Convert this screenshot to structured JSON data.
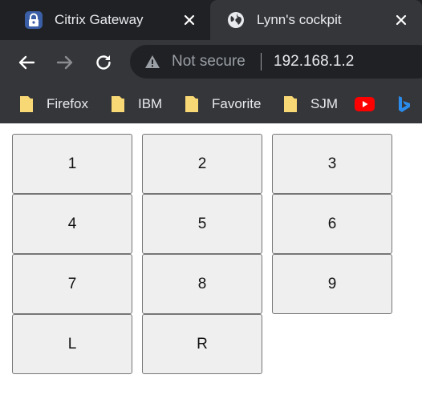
{
  "browser": {
    "tabs": [
      {
        "title": "Citrix Gateway",
        "icon": "citrix-lock-icon",
        "active": false
      },
      {
        "title": "Lynn's cockpit",
        "icon": "globe-icon",
        "active": true
      }
    ],
    "toolbar": {
      "security_label": "Not secure",
      "url": "192.168.1.2"
    },
    "bookmarks": [
      {
        "label": "Firefox",
        "icon": "folder-icon"
      },
      {
        "label": "IBM",
        "icon": "folder-icon"
      },
      {
        "label": "Favorite",
        "icon": "folder-icon"
      },
      {
        "label": "SJM",
        "icon": "folder-icon"
      },
      {
        "label": "",
        "icon": "youtube-icon"
      },
      {
        "label": "",
        "icon": "bing-icon"
      }
    ]
  },
  "keypad": {
    "keys": [
      "1",
      "2",
      "3",
      "4",
      "5",
      "6",
      "7",
      "8",
      "9",
      "L",
      "R"
    ]
  },
  "colors": {
    "tabstrip_bg": "#202124",
    "toolbar_bg": "#35363a",
    "folder_yellow": "#f8d775",
    "youtube_red": "#ff0000",
    "bing_blue": "#2b8cec",
    "button_bg": "#efefef",
    "button_border": "#767676"
  }
}
